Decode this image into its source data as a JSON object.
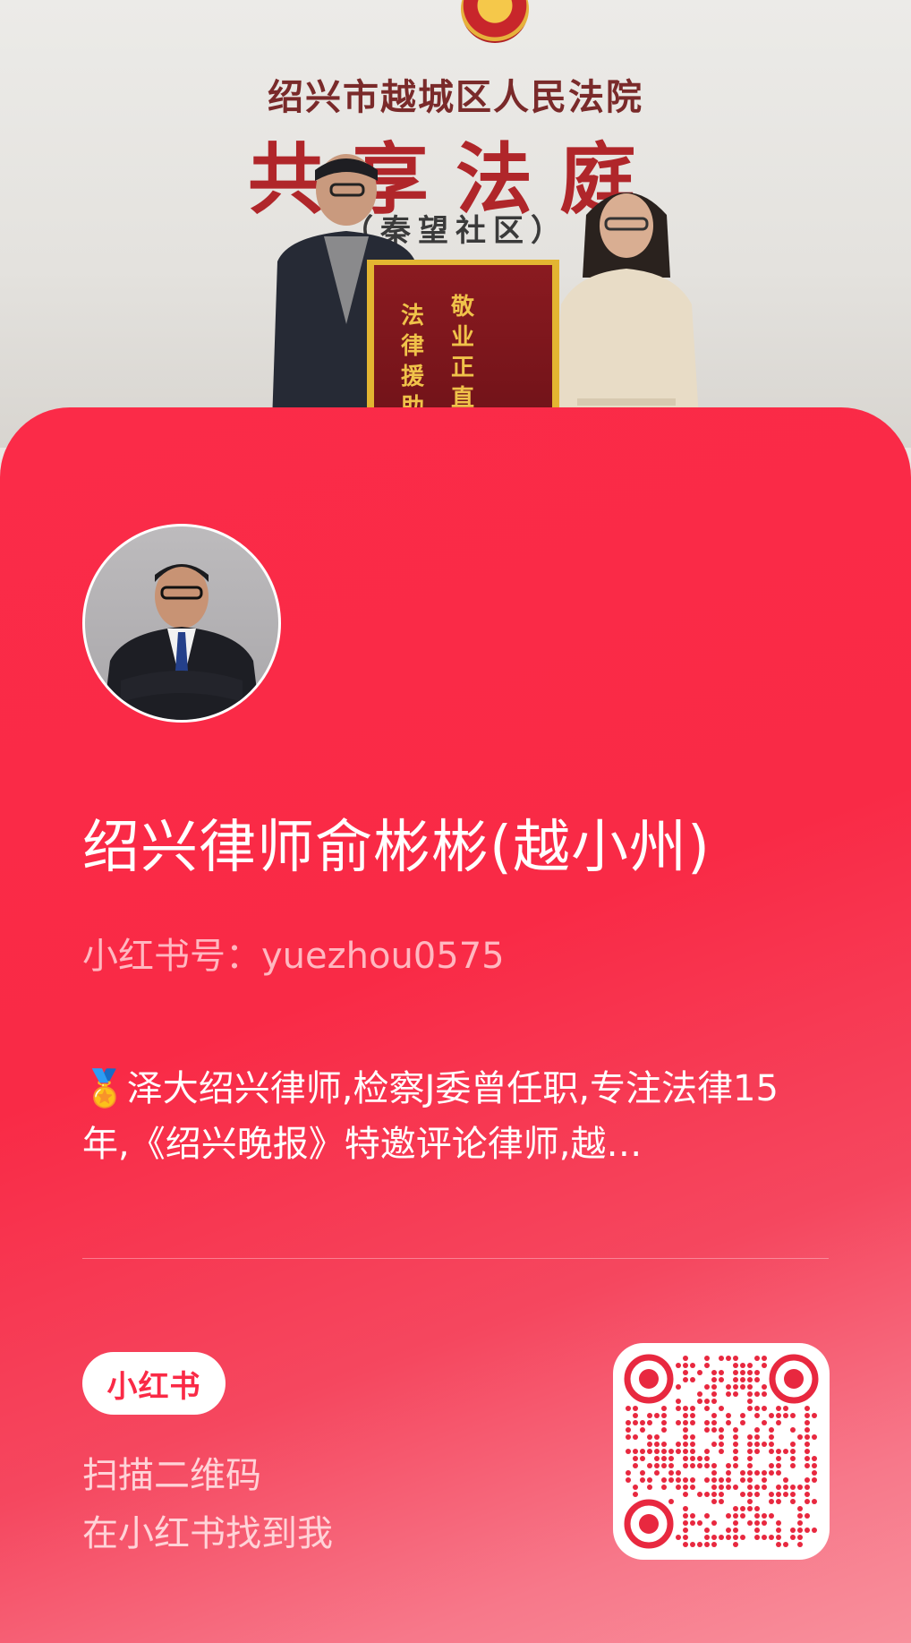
{
  "photo": {
    "court_name": "绍兴市越城区人民法院",
    "court_main": "共享法庭",
    "court_sub": "（秦望社区）",
    "banner_line1": "敬业正直",
    "banner_line2": "法律援助"
  },
  "profile": {
    "name": "绍兴律师俞彬彬(越小州)",
    "red_id": "小红书号：yuezhou0575",
    "bio": "🏅泽大绍兴律师,检察J委曾任职,专注法律15年,《绍兴晚报》特邀评论律师,越…"
  },
  "footer": {
    "logo_text": "小红书",
    "scan_line1": "扫描二维码",
    "scan_line2": "在小红书找到我"
  },
  "colors": {
    "card_red": "#fb2b48",
    "logo_red": "#fa2a46",
    "qr_red": "#e8283f"
  },
  "icons": {
    "medal": "medal-icon",
    "qr": "qr-code"
  }
}
